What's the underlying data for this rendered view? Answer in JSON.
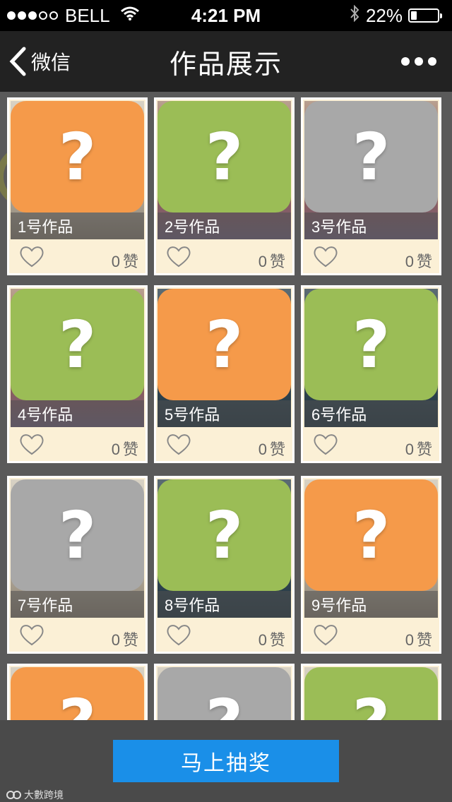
{
  "status_bar": {
    "signal_dots": 5,
    "signal_filled": 3,
    "carrier": "BELL",
    "time": "4:21 PM",
    "battery_text": "22%",
    "battery_level": 0.22
  },
  "nav": {
    "back_label": "微信",
    "title": "作品展示"
  },
  "colors": {
    "orange": "#f59a4a",
    "green": "#9bbd56",
    "gray": "#a8a8a8",
    "accent": "#1a8fe8"
  },
  "works": [
    {
      "label": "1号作品",
      "likes": "0",
      "like_unit": "赞",
      "q": "?",
      "color": "orange"
    },
    {
      "label": "2号作品",
      "likes": "0",
      "like_unit": "赞",
      "q": "?",
      "color": "green"
    },
    {
      "label": "3号作品",
      "likes": "0",
      "like_unit": "赞",
      "q": "?",
      "color": "gray"
    },
    {
      "label": "4号作品",
      "likes": "0",
      "like_unit": "赞",
      "q": "?",
      "color": "green"
    },
    {
      "label": "5号作品",
      "likes": "0",
      "like_unit": "赞",
      "q": "?",
      "color": "orange"
    },
    {
      "label": "6号作品",
      "likes": "0",
      "like_unit": "赞",
      "q": "?",
      "color": "green"
    },
    {
      "label": "7号作品",
      "likes": "0",
      "like_unit": "赞",
      "q": "?",
      "color": "gray"
    },
    {
      "label": "8号作品",
      "likes": "0",
      "like_unit": "赞",
      "q": "?",
      "color": "green"
    },
    {
      "label": "9号作品",
      "likes": "0",
      "like_unit": "赞",
      "q": "?",
      "color": "orange"
    },
    {
      "label": "",
      "likes": "",
      "like_unit": "",
      "q": "?",
      "color": "orange"
    },
    {
      "label": "",
      "likes": "",
      "like_unit": "",
      "q": "?",
      "color": "gray"
    },
    {
      "label": "",
      "likes": "",
      "like_unit": "",
      "q": "?",
      "color": "green"
    }
  ],
  "action": {
    "draw_label": "马上抽奖"
  },
  "watermark": {
    "text": "大數跨境"
  }
}
